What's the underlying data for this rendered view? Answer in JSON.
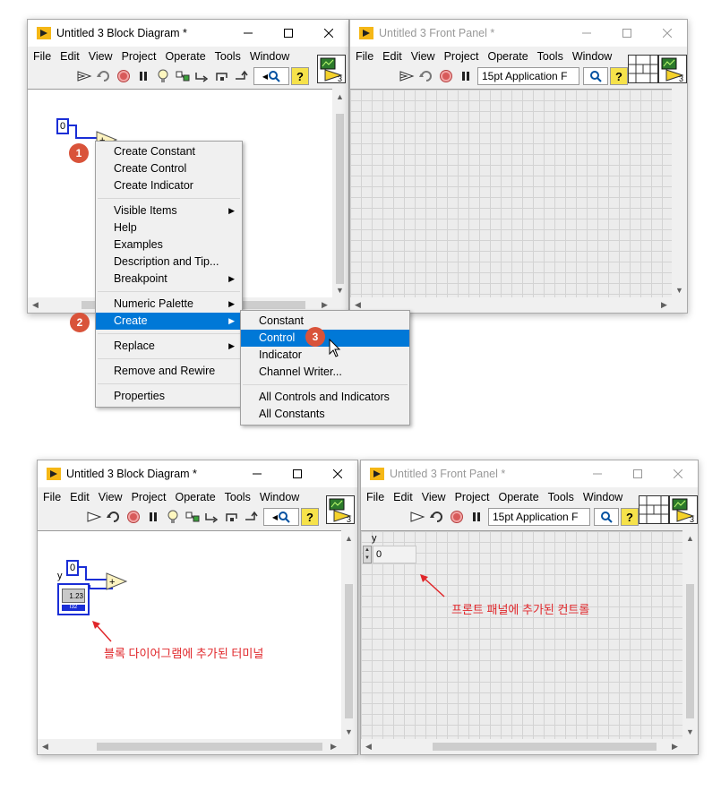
{
  "menu_items": [
    "File",
    "Edit",
    "View",
    "Project",
    "Operate",
    "Tools",
    "Window"
  ],
  "font_select": "15pt Application F",
  "help_glyph": "?",
  "windows": {
    "bd_top": {
      "title": "Untitled 3 Block Diagram *"
    },
    "fp_top": {
      "title": "Untitled 3 Front Panel *"
    },
    "bd_bottom": {
      "title": "Untitled 3 Block Diagram *"
    },
    "fp_bottom": {
      "title": "Untitled 3 Front Panel *"
    }
  },
  "diagram": {
    "constant_value": "0",
    "add_symbol": "+",
    "terminal_label": "y",
    "terminal_text": "1.23",
    "terminal_dtype": "I32"
  },
  "control": {
    "label": "y",
    "value": "0"
  },
  "context_menu": {
    "items": [
      {
        "label": "Create Constant",
        "submenu": false
      },
      {
        "label": "Create Control",
        "submenu": false
      },
      {
        "label": "Create Indicator",
        "submenu": false
      },
      {
        "label": "Visible Items",
        "submenu": true
      },
      {
        "label": "Help",
        "submenu": false
      },
      {
        "label": "Examples",
        "submenu": false
      },
      {
        "label": "Description and Tip...",
        "submenu": false
      },
      {
        "label": "Breakpoint",
        "submenu": true
      },
      {
        "label": "Numeric Palette",
        "submenu": true
      },
      {
        "label": "Create",
        "submenu": true,
        "selected": true
      },
      {
        "label": "Replace",
        "submenu": true
      },
      {
        "label": "Remove and Rewire",
        "submenu": false
      },
      {
        "label": "Properties",
        "submenu": false
      }
    ]
  },
  "submenu": {
    "items": [
      {
        "label": "Constant"
      },
      {
        "label": "Control",
        "selected": true
      },
      {
        "label": "Indicator"
      },
      {
        "label": "Channel Writer..."
      },
      {
        "label": "All Controls and Indicators"
      },
      {
        "label": "All Constants"
      }
    ]
  },
  "badges": [
    "1",
    "2",
    "3"
  ],
  "annotations": {
    "terminal_note": "블록 다이어그램에 추가된 터미널",
    "control_note": "프론트 패널에 추가된 컨트롤"
  },
  "colors": {
    "accent": "#0078d7",
    "badge": "#d9533a",
    "annotation": "#e0262a",
    "wire": "#1a2ed6"
  }
}
